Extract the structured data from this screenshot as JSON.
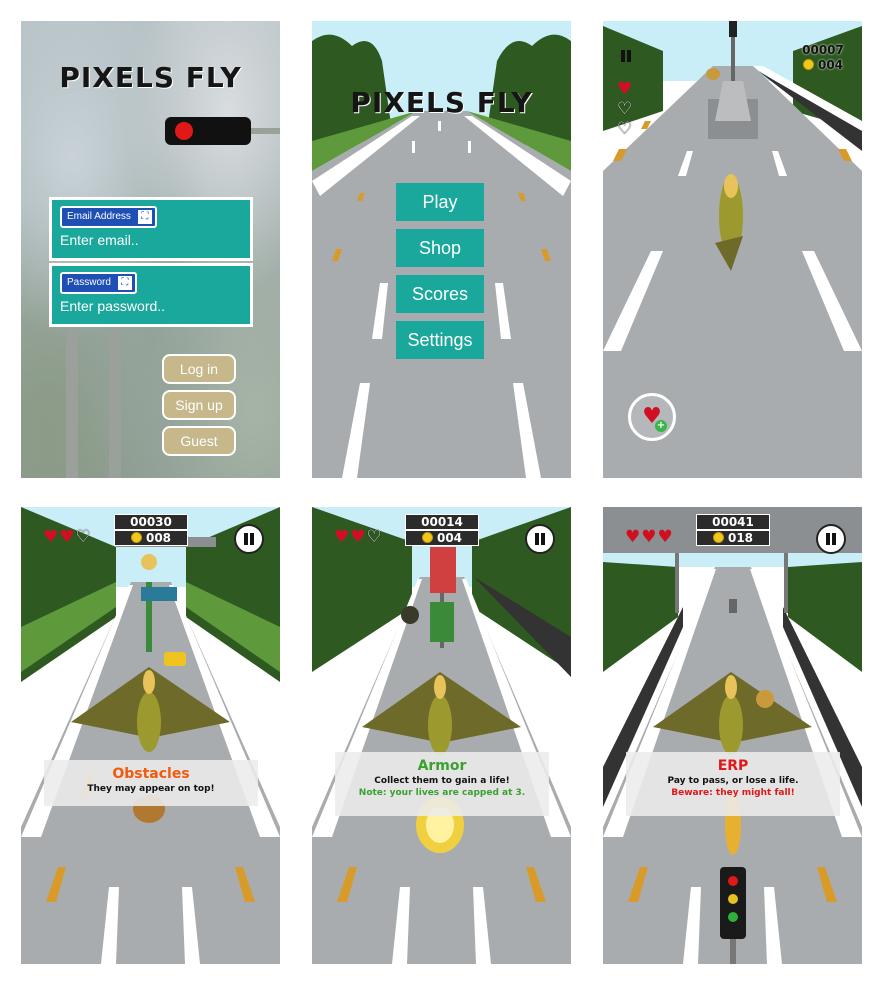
{
  "game_title": "PIXELS FLY",
  "login": {
    "email_label": "Email Address",
    "email_placeholder": "Enter email..",
    "password_label": "Password",
    "password_placeholder": "Enter password..",
    "login_button": "Log in",
    "signup_button": "Sign up",
    "guest_button": "Guest"
  },
  "menu": {
    "items": [
      "Play",
      "Shop",
      "Scores",
      "Settings"
    ]
  },
  "screens": [
    {
      "id": "p3",
      "score": "00007",
      "coins": "004",
      "lives_full": 1,
      "lives_max": 3
    },
    {
      "id": "p4",
      "score": "00030",
      "coins": "008",
      "lives_full": 2,
      "lives_max": 3,
      "tooltip": {
        "title": "Obstacles",
        "title_color": "#f25a0c",
        "lines": [
          "They may appear on top!"
        ]
      }
    },
    {
      "id": "p5",
      "score": "00014",
      "coins": "004",
      "lives_full": 2,
      "lives_max": 3,
      "tooltip": {
        "title": "Armor",
        "title_color": "#3aa12f",
        "lines": [
          "Collect them to gain a life!",
          "Note: your lives are capped at 3."
        ],
        "line_colors": [
          "#111111",
          "#3aa12f"
        ]
      }
    },
    {
      "id": "p6",
      "score": "00041",
      "coins": "018",
      "lives_full": 3,
      "lives_max": 3,
      "tooltip": {
        "title": "ERP",
        "title_color": "#e01818",
        "lines": [
          "Pay to pass, or lose a life.",
          "Beware: they might fall!"
        ],
        "line_colors": [
          "#111111",
          "#e01818"
        ]
      }
    }
  ],
  "icons": {
    "heart": "heart-icon",
    "coin": "coin-icon",
    "pause": "pause-icon",
    "road_sign": "road-sign-icon",
    "add_life": "heart-plus-icon"
  },
  "colors": {
    "teal": "#1aa89c",
    "road": "#a9acae",
    "grass": "#5e9a3c",
    "sky": "#c9eef7"
  }
}
